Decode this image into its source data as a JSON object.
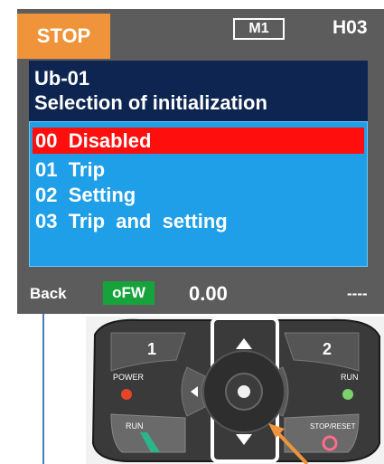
{
  "status": {
    "state": "STOP",
    "monitor_mode": "M1",
    "param_code": "H03"
  },
  "header": {
    "code": "Ub-01",
    "title": "Selection of initialization"
  },
  "options": [
    {
      "label": "00  Disabled",
      "selected": true
    },
    {
      "label": "01  Trip",
      "selected": false
    },
    {
      "label": "02  Setting",
      "selected": false
    },
    {
      "label": "03  Trip  and  setting",
      "selected": false
    }
  ],
  "footer": {
    "back_label": "Back",
    "badge": "oFW",
    "value": "0.00",
    "right": "----"
  },
  "keypad": {
    "key1": "1",
    "key2": "2",
    "power": "POWER",
    "run": "RUN",
    "run_key": "RUN",
    "stop_reset": "STOP/RESET"
  },
  "colors": {
    "stop_bg": "#f0943c",
    "selected_bg": "#ff0e0e",
    "list_bg": "#1e9fe8",
    "title_bg": "#0d2550",
    "badge_bg": "#17a33c"
  }
}
